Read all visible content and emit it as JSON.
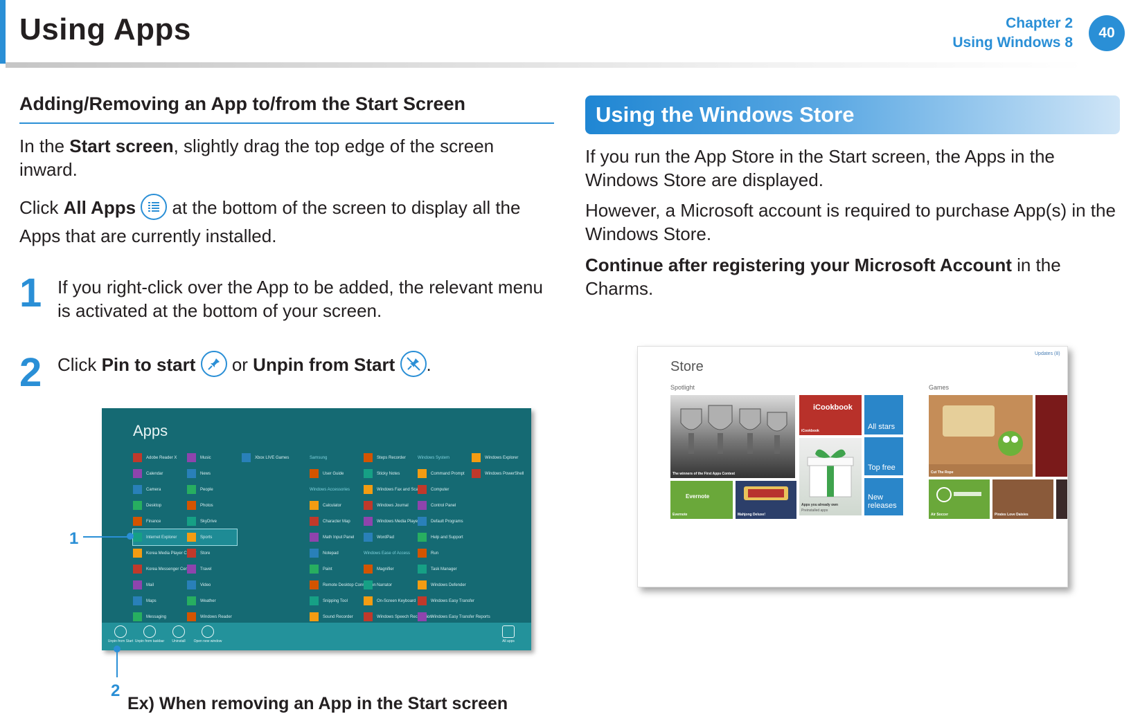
{
  "header": {
    "title": "Using Apps",
    "chapter_line1": "Chapter 2",
    "chapter_line2": "Using Windows 8",
    "page_number": "40"
  },
  "left": {
    "heading": "Adding/Removing an App to/from the Start Screen",
    "para1_pre": "In the ",
    "para1_bold": "Start screen",
    "para1_post": ", slightly drag the top edge of the screen inward.",
    "para2_pre": "Click ",
    "para2_bold": "All Apps",
    "para2_post": " at the bottom of the screen to display all the Apps that are currently installed.",
    "step1_num": "1",
    "step1_text": "If you right-click over the App to be added, the relevant menu is activated at the bottom of your screen.",
    "step2_num": "2",
    "step2_pre": "Click ",
    "step2_bold1": "Pin to start",
    "step2_mid": " or ",
    "step2_bold2": "Unpin from Start",
    "step2_post": ".",
    "callout1": "1",
    "callout2": "2",
    "caption": "Ex) When removing an App in the Start screen"
  },
  "apps_screen": {
    "title": "Apps",
    "columns": [
      [
        "Adobe Reader X",
        "Calendar",
        "Camera",
        "Desktop",
        "Finance",
        "Internet Explorer",
        "Korea Media Player Center",
        "Korea Messenger Center",
        "Mail",
        "Maps",
        "Messaging"
      ],
      [
        "Music",
        "News",
        "People",
        "Photos",
        "SkyDrive",
        "Sports",
        "Store",
        "Travel",
        "Video",
        "Weather",
        "Windows Reader"
      ],
      [
        "Xbox LIVE Games"
      ],
      [
        "Samsung",
        "User Guide",
        "Windows Accessories",
        "Calculator",
        "Character Map",
        "Math Input Panel",
        "Notepad",
        "Paint",
        "Remote Desktop Connection",
        "Snipping Tool",
        "Sound Recorder"
      ],
      [
        "Steps Recorder",
        "Sticky Notes",
        "Windows Fax and Scan",
        "Windows Journal",
        "Windows Media Player",
        "WordPad",
        "Windows Ease of Access",
        "Magnifier",
        "Narrator",
        "On-Screen Keyboard",
        "Windows Speech Recognition"
      ],
      [
        "Windows System",
        "Command Prompt",
        "Computer",
        "Control Panel",
        "Default Programs",
        "Help and Support",
        "Run",
        "Task Manager",
        "Windows Defender",
        "Windows Easy Transfer",
        "Windows Easy Transfer Reports"
      ],
      [
        "Windows Explorer",
        "Windows PowerShell"
      ]
    ],
    "bar_buttons": [
      "Unpin from Start",
      "Unpin from taskbar",
      "Uninstall",
      "Open new window"
    ],
    "all_apps_label": "All apps"
  },
  "store_section": {
    "heading": "Using the Windows Store",
    "para1": "If you run the App Store in the Start screen, the Apps in the Windows Store are displayed.",
    "para2": "However, a Microsoft account is required to purchase App(s) in the Windows Store.",
    "para3_bold": "Continue after registering your Microsoft Account",
    "para3_post": " in the Charms."
  },
  "store_screen": {
    "title": "Store",
    "updates": "Updates (8)",
    "spotlight": "Spotlight",
    "games": "Games",
    "tiles": {
      "winners": "The winners of the First Apps Contest",
      "icookbook_logo": "iCookbook",
      "icookbook": "iCookbook",
      "all_stars": "All stars",
      "top_free": "Top free",
      "new_releases": "New releases",
      "evernote": "Evernote",
      "mahjong": "Mahjong Deluxe!",
      "apps_you_own": "Apps you already own",
      "preinstalled": "Preinstalled apps",
      "cut_the_rope": "Cut The Rope",
      "air_soccer": "Air Soccer",
      "pirates": "Pirates Love Daisies"
    }
  },
  "colors": {
    "accent": "#2a8fd6",
    "apps_bg": "#156a73",
    "apps_bar": "#23929b"
  }
}
